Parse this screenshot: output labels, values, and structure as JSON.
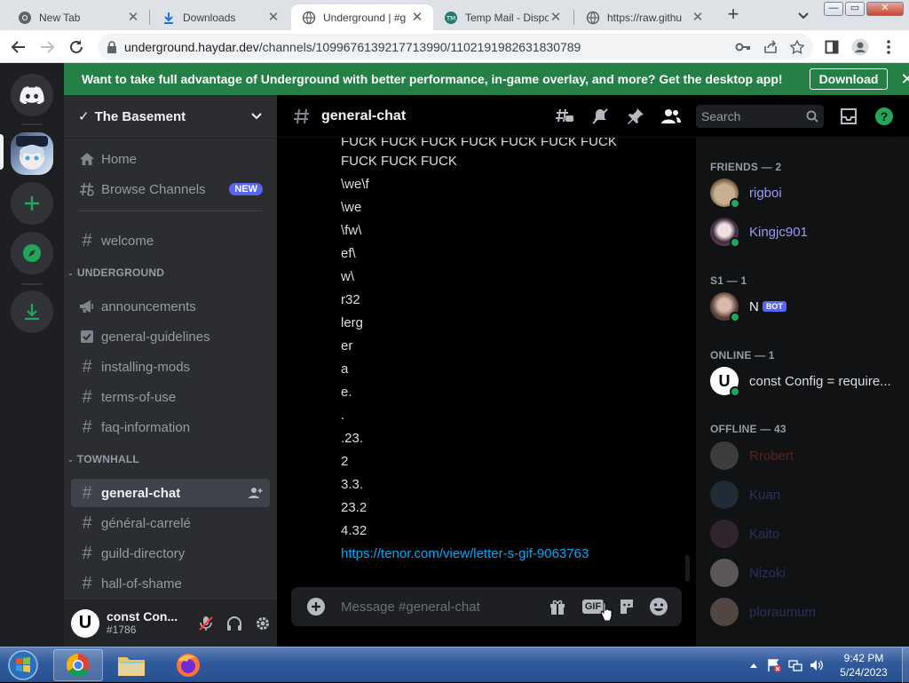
{
  "browser": {
    "tabs": [
      {
        "label": "New Tab",
        "icon": "chrome-icon"
      },
      {
        "label": "Downloads",
        "icon": "download-icon"
      },
      {
        "label": "Underground | #g",
        "icon": "globe-icon",
        "active": true
      },
      {
        "label": "Temp Mail - Dispo",
        "icon": "tempmail-icon"
      },
      {
        "label": "https://raw.githu",
        "icon": "globe-icon"
      }
    ],
    "url_host": "underground.haydar.dev",
    "url_path": "/channels/1099676139217713990/1102191982631830789",
    "window_controls": [
      "—",
      "▭",
      "✕"
    ]
  },
  "banner": {
    "text": "Want to take full advantage of Underground with better performance, in-game overlay, and more? Get the desktop app!",
    "download_label": "Download",
    "close": "✕"
  },
  "server": {
    "name": "The Basement",
    "top_items": [
      {
        "label": "Home",
        "icon": "home-icon"
      },
      {
        "label": "Browse Channels",
        "icon": "browse-channels-icon",
        "badge": "NEW"
      }
    ],
    "welcome": "welcome",
    "categories": [
      {
        "name": "UNDERGROUND",
        "channels": [
          {
            "name": "announcements",
            "icon": "megaphone-icon"
          },
          {
            "name": "general-guidelines",
            "icon": "rules-icon"
          },
          {
            "name": "installing-mods",
            "icon": "hash-icon"
          },
          {
            "name": "terms-of-use",
            "icon": "hash-icon"
          },
          {
            "name": "faq-information",
            "icon": "hash-icon"
          }
        ]
      },
      {
        "name": "TOWNHALL",
        "channels": [
          {
            "name": "general-chat",
            "icon": "hash-icon",
            "selected": true
          },
          {
            "name": "général-carrelé",
            "icon": "hash-icon"
          },
          {
            "name": "guild-directory",
            "icon": "hash-icon"
          },
          {
            "name": "hall-of-shame",
            "icon": "hash-icon"
          }
        ]
      }
    ]
  },
  "user": {
    "name": "const Con...",
    "tag": "#1786",
    "avatar_letter": "U"
  },
  "channel": {
    "name": "general-chat",
    "search_placeholder": "Search"
  },
  "messages": [
    "FUCK FUCK FUCK FUCK FUCK FUCK FUCK",
    "FUCK FUCK FUCK",
    "\\we\\f",
    "\\we",
    "\\fw\\",
    "ef\\",
    "w\\",
    "r32",
    "lerg",
    "er",
    "a",
    "e.",
    ".",
    ".23.",
    "2",
    "3.3.",
    "23.2",
    "4.32",
    "https://tenor.com/view/letter-s-gif-9063763"
  ],
  "composer": {
    "placeholder": "Message #general-chat",
    "gif_label": "GIF"
  },
  "members": {
    "friends_header": "FRIENDS — 2",
    "friends": [
      {
        "name": "rigboi",
        "color": "#949cf7"
      },
      {
        "name": "Kingjc901",
        "color": "#949cf7"
      }
    ],
    "s1_header": "S1 — 1",
    "s1": [
      {
        "name": "N",
        "bot": "BOT",
        "color": "#f2f3f5"
      }
    ],
    "online_header": "ONLINE — 1",
    "online": [
      {
        "name": "const Config = require...",
        "color": "#dbdee1"
      }
    ],
    "offline_header": "OFFLINE — 43",
    "offline": [
      {
        "name": "Rrobert",
        "color": "#e03c3c"
      },
      {
        "name": "Kuan",
        "color": "#5865f2"
      },
      {
        "name": "Kaito",
        "color": "#5865f2"
      },
      {
        "name": "Nizoki",
        "color": "#5865f2"
      },
      {
        "name": "ploraumum",
        "color": "#5865f2"
      }
    ]
  },
  "taskbar": {
    "time": "9:42 PM",
    "date": "5/24/2023"
  },
  "colors": {
    "discord_bg": "#000000",
    "sidebar": "#2b2d31",
    "banner": "#248046",
    "blurple": "#5865f2",
    "link": "#00a8fc"
  }
}
